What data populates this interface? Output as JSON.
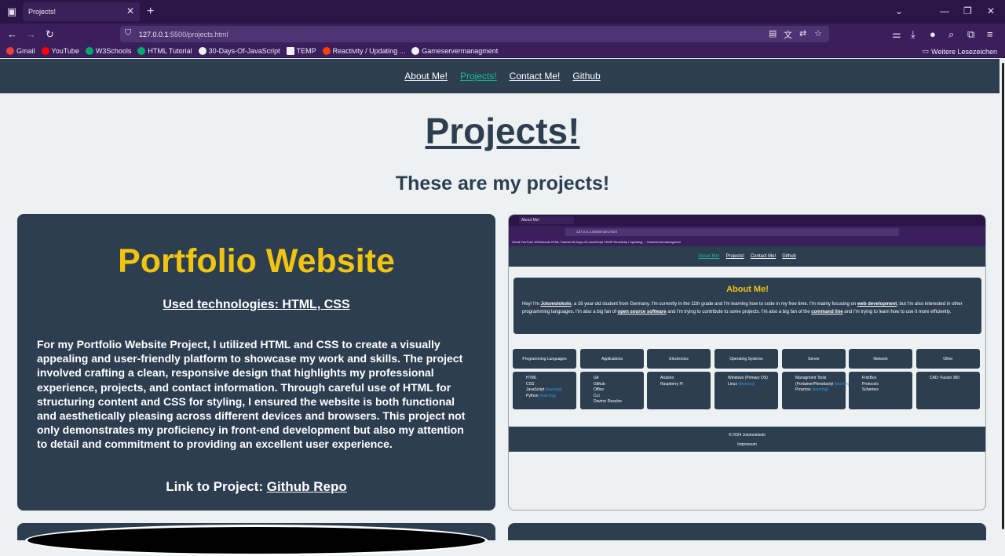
{
  "browser": {
    "tab_title": "Projects!",
    "url_host": "127.0.0.1",
    "url_path": ":5500/projects.html",
    "icons": {
      "tab_list": "tab-list-icon",
      "close_tab": "close-icon",
      "new_tab": "plus-icon",
      "back": "arrow-left-icon",
      "forward": "arrow-right-icon",
      "reload": "reload-icon"
    },
    "bookmarks": [
      {
        "label": "Gmail",
        "color": "#ea4335"
      },
      {
        "label": "YouTube",
        "color": "#ff0000"
      },
      {
        "label": "W3Schools",
        "color": "#04aa6d"
      },
      {
        "label": "HTML Tutorial",
        "color": "#04aa6d"
      },
      {
        "label": "30-Days-Of-JavaScript",
        "color": "#f0f0f0"
      },
      {
        "label": "TEMP",
        "color": "#f0f0f0"
      },
      {
        "label": "Reactivity / Updating ...",
        "color": "#ff3e00"
      },
      {
        "label": "Gameservermanagment",
        "color": "#f0f0f0"
      }
    ],
    "other_bookmarks": "Weitere Lesezeichen"
  },
  "site": {
    "nav": [
      "About Me!",
      "Projects!",
      "Contact Me!",
      "Github"
    ],
    "active_nav": "Projects!",
    "heading": "Projects!",
    "subheading": "These are my projects!",
    "accent": "#f1c40f",
    "link_active_color": "#1abc9c"
  },
  "project": {
    "title": "Portfolio Website",
    "tech": "Used technologies: HTML, CSS",
    "description": "For my Portfolio Website Project, I utilized HTML and CSS to create a visually appealing and user-friendly platform to showcase my work and skills. The project involved crafting a clean, responsive design that highlights my professional experience, projects, and contact information. Through careful use of HTML for structuring content and CSS for styling, I ensured the website is both functional and aesthetically pleasing across different devices and browsers. This project not only demonstrates my proficiency in front-end development but also my attention to detail and commitment to providing an excellent user experience.",
    "link_prefix": "Link to Project:",
    "link_label": "Github Repo"
  },
  "screenshot": {
    "tab_title": "About Me!",
    "url": "127.0.0.1:5500/index.html",
    "bookmarks": "Gmail  YouTube  W3Schools  HTML Tutorial  30-Days-Of-JavaScript  TEMP  Reactivity / Updating ...  Gameservermanagment",
    "about_title": "About Me!",
    "about_text_1": "Hey! I'm ",
    "about_name": "Jolomolokolo",
    "about_text_2": ", a 16 year old student from Germany. I'm currently in the 11th grade and I'm learning how to code in my free time. I'm mainly focusing on ",
    "about_link_1": "web development",
    "about_text_3": ", but I'm also interested in other programming languages. I'm also a big fan of ",
    "about_link_2": "open source software",
    "about_text_4": " and I'm trying to contribute to some projects. I'm also a big fan of the ",
    "about_link_3": "command line",
    "about_text_5": " and I'm trying to learn how to use it more efficiently.",
    "categories": [
      "Programming Languages",
      "Applications",
      "Electronics",
      "Operating Systems",
      "Server",
      "Network",
      "Other"
    ],
    "cells": [
      [
        "HTML",
        "CSS",
        "JavaScript (learning)",
        "Python (learning)"
      ],
      [
        "Git",
        "Github",
        "Office",
        "CLI",
        "Davinci Resolve"
      ],
      [
        "Arduino",
        "Raspberry Pi"
      ],
      [
        "Windows (Primary OS)",
        "Linux (learning)"
      ],
      [
        "Managment Tools",
        "(Portainer/Pterodactyl (learning)",
        "Proxmox (learning)"
      ],
      [
        "FritzBox",
        "Protocols",
        "Schemes"
      ],
      [
        "CAD: Fusion 360"
      ]
    ],
    "footer_copy": "© 2024 Jolomolokolo",
    "footer_link": "Impressum"
  }
}
